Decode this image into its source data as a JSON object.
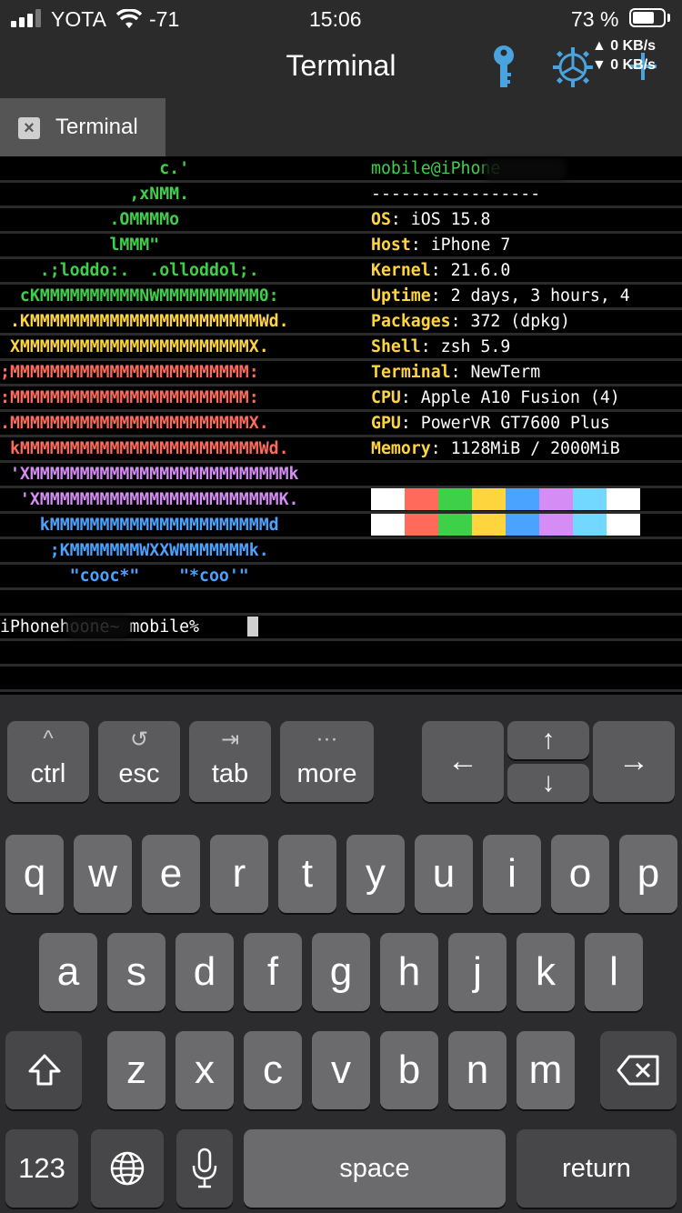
{
  "status_bar": {
    "carrier": "YOTA",
    "signal_value": "-71",
    "time": "15:06",
    "battery_percent": "73 %",
    "battery_level": 0.73,
    "upload_speed": "▲ 0 KB/s",
    "download_speed": "▼ 0 KB/s"
  },
  "nav": {
    "title": "Terminal",
    "key_icon": "key-icon",
    "settings_icon": "gear-icon",
    "add_icon": "plus-icon",
    "accent_color": "#4aa3df"
  },
  "tab": {
    "label": "Terminal",
    "close_icon": "close-icon"
  },
  "terminal": {
    "logo_lines": [
      {
        "text": "                c.'",
        "color": "#3fd04a"
      },
      {
        "text": "             ,xNMM.",
        "color": "#3fd04a"
      },
      {
        "text": "           .OMMMMo",
        "color": "#3fd04a"
      },
      {
        "text": "           lMMM\"",
        "color": "#3fd04a"
      },
      {
        "text": "    .;loddo:.  .olloddol;.",
        "color": "#3fd04a"
      },
      {
        "text": "  cKMMMMMMMMMMNWMMMMMMMMMM0:",
        "color": "#3fd04a"
      },
      {
        "text": " .KMMMMMMMMMMMMMMMMMMMMMMMWd.",
        "color": "#ffd53d"
      },
      {
        "text": " XMMMMMMMMMMMMMMMMMMMMMMMX.",
        "color": "#ffd53d"
      },
      {
        "text": ";MMMMMMMMMMMMMMMMMMMMMMMM:",
        "color": "#ff6a5a"
      },
      {
        "text": ":MMMMMMMMMMMMMMMMMMMMMMMM:",
        "color": "#ff6a5a"
      },
      {
        "text": ".MMMMMMMMMMMMMMMMMMMMMMMMX.",
        "color": "#ff6a5a"
      },
      {
        "text": " kMMMMMMMMMMMMMMMMMMMMMMMMWd.",
        "color": "#ff6a5a"
      },
      {
        "text": " 'XMMMMMMMMMMMMMMMMMMMMMMMMMMk",
        "color": "#d58cf5"
      },
      {
        "text": "  'XMMMMMMMMMMMMMMMMMMMMMMMMK.",
        "color": "#d58cf5"
      },
      {
        "text": "    kMMMMMMMMMMMMMMMMMMMMMMd",
        "color": "#4aa3ff"
      },
      {
        "text": "     ;KMMMMMMMWXXWMMMMMMMk.",
        "color": "#4aa3ff"
      },
      {
        "text": "       \"cooc*\"    \"*coo'\"",
        "color": "#4aa3ff"
      }
    ],
    "user_host": "mobile@iPhone",
    "separator": "-----------------",
    "info": [
      {
        "key": "OS",
        "value": ": iOS 15.8"
      },
      {
        "key": "Host",
        "value": ": iPhone 7"
      },
      {
        "key": "Kernel",
        "value": ": 21.6.0"
      },
      {
        "key": "Uptime",
        "value": ": 2 days, 3 hours, 4"
      },
      {
        "key": "Packages",
        "value": ": 372 (dpkg)"
      },
      {
        "key": "Shell",
        "value": ": zsh 5.9"
      },
      {
        "key": "Terminal",
        "value": ": NewTerm"
      },
      {
        "key": "CPU",
        "value": ": Apple A10 Fusion (4)"
      },
      {
        "key": "GPU",
        "value": ": PowerVR GT7600 Plus"
      },
      {
        "key": "Memory",
        "value": ": 1128MiB / 2000MiB"
      }
    ],
    "palette_rows": [
      [
        "#ffffff",
        "#ff6a5a",
        "#3fd04a",
        "#ffd53d",
        "#4aa3ff",
        "#d58cf5",
        "#72d8ff",
        "#ffffff"
      ],
      [
        "#ffffff",
        "#ff6a5a",
        "#3fd04a",
        "#ffd53d",
        "#4aa3ff",
        "#d58cf5",
        "#72d8ff",
        "#ffffff"
      ]
    ],
    "prompt_host": "iPhone",
    "prompt_host_extra": "hoone",
    "prompt_rest": "~ mobile% "
  },
  "accessory_bar": {
    "ctrl": {
      "label": "ctrl",
      "icon": "^"
    },
    "esc": {
      "label": "esc",
      "icon": "↺"
    },
    "tab": {
      "label": "tab",
      "icon": "⇥"
    },
    "more": {
      "label": "more",
      "icon": "···"
    },
    "left_arrow": "←",
    "up_arrow": "↑",
    "down_arrow": "↓",
    "right_arrow": "→"
  },
  "keyboard": {
    "row1": [
      "q",
      "w",
      "e",
      "r",
      "t",
      "y",
      "u",
      "i",
      "o",
      "p"
    ],
    "row2": [
      "a",
      "s",
      "d",
      "f",
      "g",
      "h",
      "j",
      "k",
      "l"
    ],
    "row3": [
      "z",
      "x",
      "c",
      "v",
      "b",
      "n",
      "m"
    ],
    "numbers_label": "123",
    "space_label": "space",
    "return_label": "return",
    "shift_icon": "shift-icon",
    "delete_icon": "delete-icon",
    "globe_icon": "globe-icon",
    "mic_icon": "microphone-icon"
  }
}
